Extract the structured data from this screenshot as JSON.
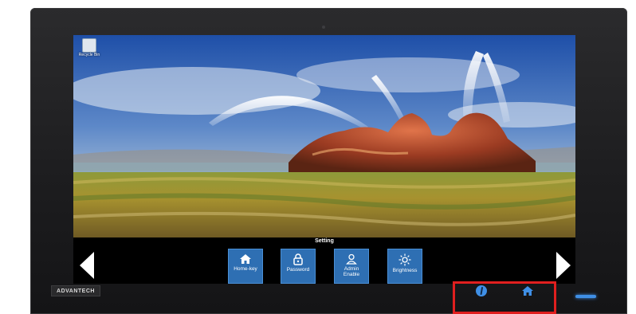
{
  "desktop": {
    "recycle_bin_label": "Recycle Bin"
  },
  "osd": {
    "title": "Setting",
    "tiles": [
      {
        "label": "Home-key",
        "icon": "home-icon"
      },
      {
        "label": "Password",
        "icon": "lock-icon"
      },
      {
        "label": "Admin\nEnable",
        "icon": "user-icon"
      },
      {
        "label": "Brightness",
        "icon": "sun-icon"
      }
    ],
    "nav": {
      "prev_icon": "arrow-left-icon",
      "next_icon": "arrow-right-icon"
    }
  },
  "bezel": {
    "brand": "ADVANTECH",
    "buttons": [
      {
        "icon": "info-icon"
      },
      {
        "icon": "home-icon"
      }
    ],
    "highlight_color": "#e01f1f",
    "led_color": "#3f8fe6"
  },
  "colors": {
    "tile_bg": "#2e6fb3",
    "bezel": "#1c1c1e"
  }
}
